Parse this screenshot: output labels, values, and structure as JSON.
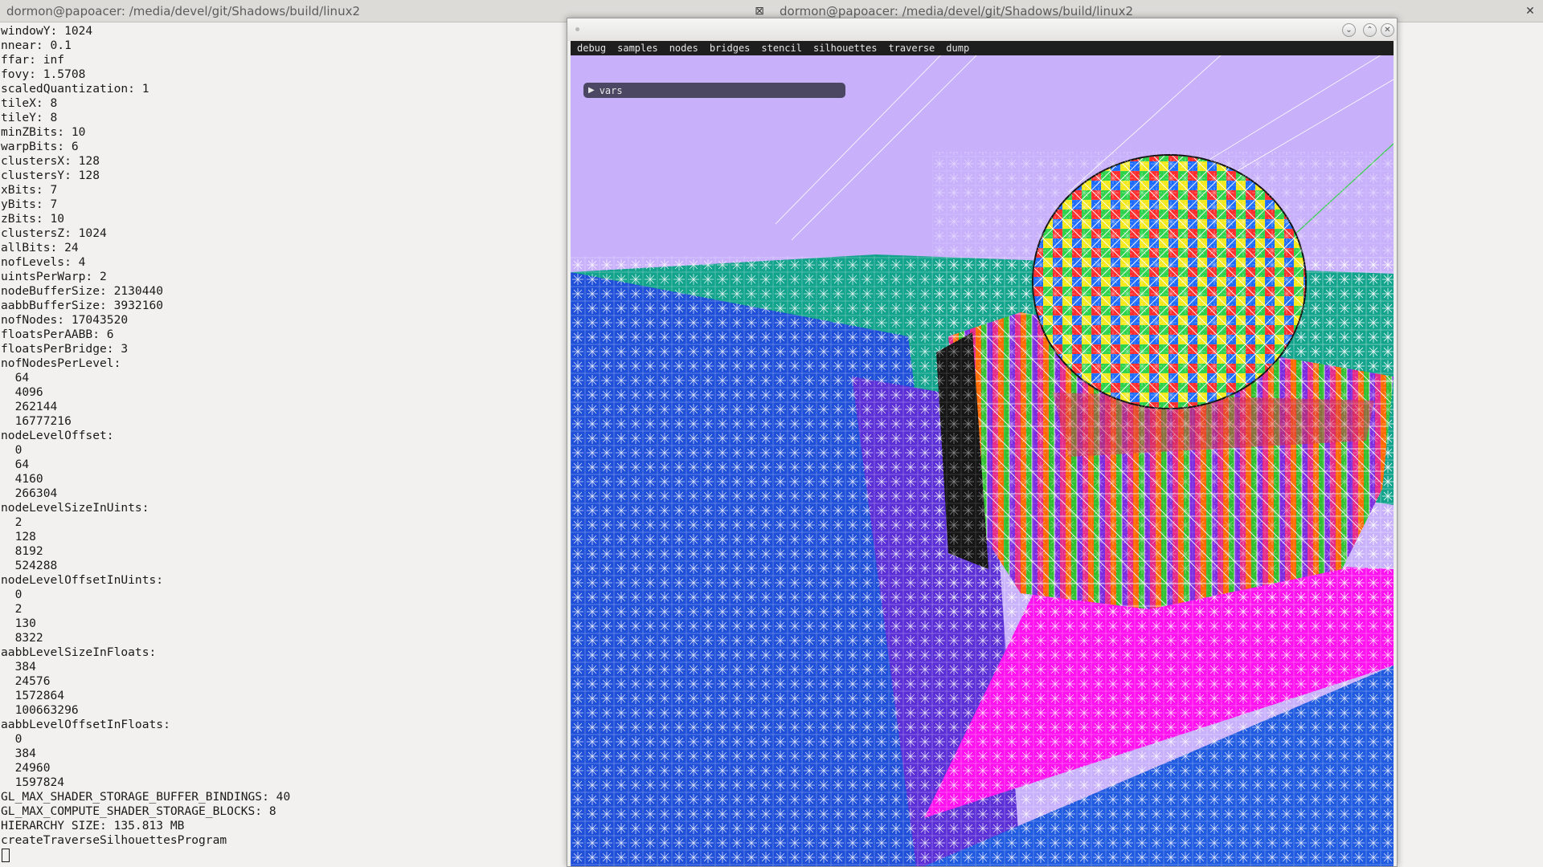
{
  "tabs": [
    {
      "title": "dormon@papoacer: /media/devel/git/Shadows/build/linux2",
      "close_glyph": "⊠"
    },
    {
      "title": "dormon@papoacer: /media/devel/git/Shadows/build/linux2",
      "close_glyph": "✕"
    }
  ],
  "terminal": {
    "lines": [
      "windowY: 1024",
      "nnear: 0.1",
      "ffar: inf",
      "fovy: 1.5708",
      "scaledQuantization: 1",
      "tileX: 8",
      "tileY: 8",
      "minZBits: 10",
      "warpBits: 6",
      "clustersX: 128",
      "clustersY: 128",
      "xBits: 7",
      "yBits: 7",
      "zBits: 10",
      "clustersZ: 1024",
      "allBits: 24",
      "nofLevels: 4",
      "uintsPerWarp: 2",
      "nodeBufferSize: 2130440",
      "aabbBufferSize: 3932160",
      "nofNodes: 17043520",
      "floatsPerAABB: 6",
      "floatsPerBridge: 3",
      "nofNodesPerLevel:",
      "  64",
      "  4096",
      "  262144",
      "  16777216",
      "nodeLevelOffset:",
      "  0",
      "  64",
      "  4160",
      "  266304",
      "nodeLevelSizeInUints:",
      "  2",
      "  128",
      "  8192",
      "  524288",
      "nodeLevelOffsetInUints:",
      "  0",
      "  2",
      "  130",
      "  8322",
      "aabbLevelSizeInFloats:",
      "  384",
      "  24576",
      "  1572864",
      "  100663296",
      "aabbLevelOffsetInFloats:",
      "  0",
      "  384",
      "  24960",
      "  1597824",
      "GL_MAX_SHADER_STORAGE_BUFFER_BINDINGS: 40",
      "GL_MAX_COMPUTE_SHADER_STORAGE_BLOCKS: 8",
      "HIERARCHY SIZE: 135.813 MB",
      "createTraverseSilhouettesProgram"
    ]
  },
  "app_window": {
    "buttons": {
      "minimize": "⌄",
      "maximize": "⌃",
      "close": "✕"
    },
    "menu": [
      "debug",
      "samples",
      "nodes",
      "bridges",
      "stencil",
      "silhouettes",
      "traverse",
      "dump"
    ],
    "vars_panel": {
      "arrow": "▶",
      "label": "vars"
    }
  },
  "colors": {
    "sky": "#c8b0fb",
    "floor_blue": "#1f5ae0",
    "floor_teal": "#11a38c",
    "floor_purple": "#5b2fd6",
    "magenta": "#ff10ee",
    "wire": "#ffffff"
  }
}
